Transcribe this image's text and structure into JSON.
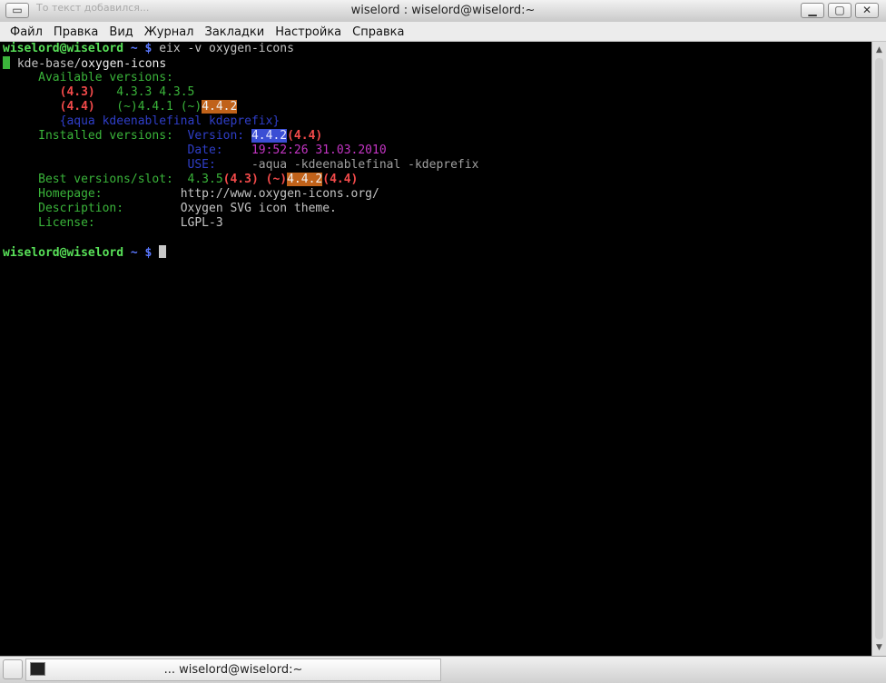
{
  "window": {
    "title": "wiselord : wiselord@wiselord:~",
    "ghost_text": "То текст добавился..."
  },
  "menu": [
    "Файл",
    "Правка",
    "Вид",
    "Журнал",
    "Закладки",
    "Настройка",
    "Справка"
  ],
  "terminal": {
    "prompt_user": "wiselord@wiselord",
    "prompt_dir": "~ $",
    "command": "eix -v oxygen-icons",
    "pkg_category": "kde-base/",
    "pkg_name": "oxygen-icons",
    "available_label": "Available versions:",
    "slot1": "(4.3)",
    "slot1_versions": "4.3.3 4.3.5",
    "slot2": "(4.4)",
    "slot2_v1": "(~)4.4.1",
    "slot2_v2_prefix": "(~)",
    "slot2_v2": "4.4.2",
    "use_flags": "{aqua kdeenablefinal kdeprefix}",
    "installed_label": "Installed versions:",
    "version_label": "Version:",
    "version_value": "4.4.2",
    "version_slot": "(4.4)",
    "date_label": "Date:",
    "date_value": "19:52:26 31.03.2010",
    "use_label": "USE:",
    "use_value": "-aqua -kdeenablefinal -kdeprefix",
    "best_label": "Best versions/slot:",
    "best_v1": "4.3.5",
    "best_s1": "(4.3)",
    "best_prefix": "(~)",
    "best_v2": "4.4.2",
    "best_s2": "(4.4)",
    "homepage_label": "Homepage:",
    "homepage_value": "http://www.oxygen-icons.org/",
    "description_label": "Description:",
    "description_value": "Oxygen SVG icon theme.",
    "license_label": "License:",
    "license_value": "LGPL-3"
  },
  "taskbar": {
    "task_label": "... wiselord@wiselord:~"
  },
  "icons": {
    "window_menu": "window-menu-icon",
    "minimize": "minimize-icon",
    "maximize": "maximize-icon",
    "close": "close-icon",
    "terminal": "terminal-icon"
  }
}
